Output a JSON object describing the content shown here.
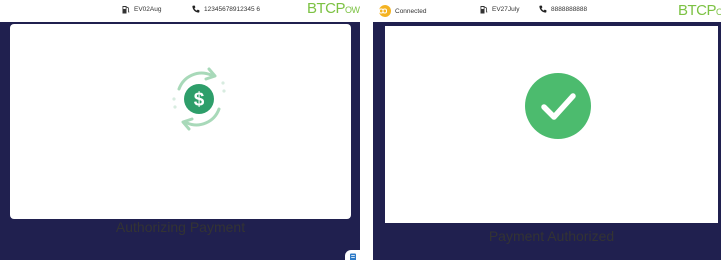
{
  "left_screen": {
    "status": {
      "terminal_id": "EV02Aug",
      "phone": "12345678912345 6",
      "logo_main": "BTCP",
      "logo_small": "OWEF"
    },
    "message": "Authorizing Payment",
    "icon": "dollar-refresh-icon"
  },
  "right_screen": {
    "status": {
      "connection": "Connected",
      "terminal_id": "EV27July",
      "phone": "8888888888",
      "logo_main": "BTCP",
      "logo_small": "OW"
    },
    "message": "Payment Authorized",
    "icon": "checkmark-icon"
  },
  "colors": {
    "background": "#20204f",
    "accent_green": "#2e9e6a",
    "success_green": "#4cbb6e",
    "logo_green": "#7cc243",
    "connected_yellow": "#f4b322"
  }
}
